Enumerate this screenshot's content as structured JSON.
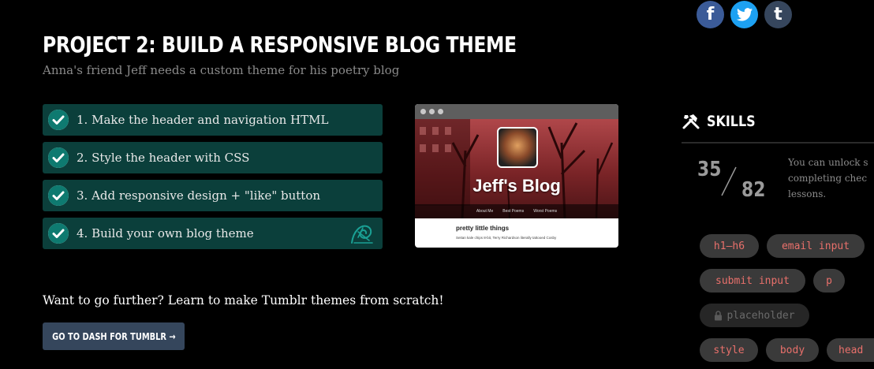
{
  "social": {
    "facebook_icon": "f",
    "twitter_icon": "twitter-bird",
    "tumblr_icon": "t",
    "colors": {
      "facebook": "#3b5b98",
      "twitter": "#1da1f2",
      "tumblr": "#36465d"
    }
  },
  "project": {
    "title": "PROJECT 2: BUILD A RESPONSIVE BLOG THEME",
    "subtitle": "Anna's friend Jeff needs a custom theme for his poetry blog"
  },
  "steps": [
    {
      "label": "1. Make the header and navigation HTML",
      "completed": true
    },
    {
      "label": "2. Style the header with CSS",
      "completed": true
    },
    {
      "label": "3. Add responsive design + \"like\" button",
      "completed": true
    },
    {
      "label": "4. Build your own blog theme",
      "completed": true,
      "icon": "tumbleweed-icon"
    }
  ],
  "preview": {
    "blog_title": "Jeff's Blog",
    "nav": [
      "About Me",
      "Best Poems",
      "Worst Poems"
    ],
    "post_title": "pretty little things",
    "post_text": "Seitan kale chips 8-bit, Terry Richardson literally tattooed Cosby"
  },
  "further": {
    "text": "Want to go further? Learn to make Tumblr themes from scratch!",
    "button": "GO TO DASH FOR TUMBLR →"
  },
  "skills": {
    "title": "SKILLS",
    "count": "35",
    "total": "82",
    "unlock_lines": [
      "You can unlock s",
      "completing chec",
      "lessons."
    ],
    "tags": [
      {
        "label": "h1–h6",
        "locked": false
      },
      {
        "label": "email input",
        "locked": false
      },
      {
        "label": "submit input",
        "locked": false
      },
      {
        "label": "p",
        "locked": false
      },
      {
        "label": "placeholder",
        "locked": true
      },
      {
        "label": "style",
        "locked": false
      },
      {
        "label": "body",
        "locked": false
      },
      {
        "label": "head",
        "locked": false
      }
    ]
  },
  "colors": {
    "step_bg": "#0b3f3b",
    "check": "#0e7a70",
    "tag_text": "#e8706b",
    "cta_bg": "#35465c"
  }
}
